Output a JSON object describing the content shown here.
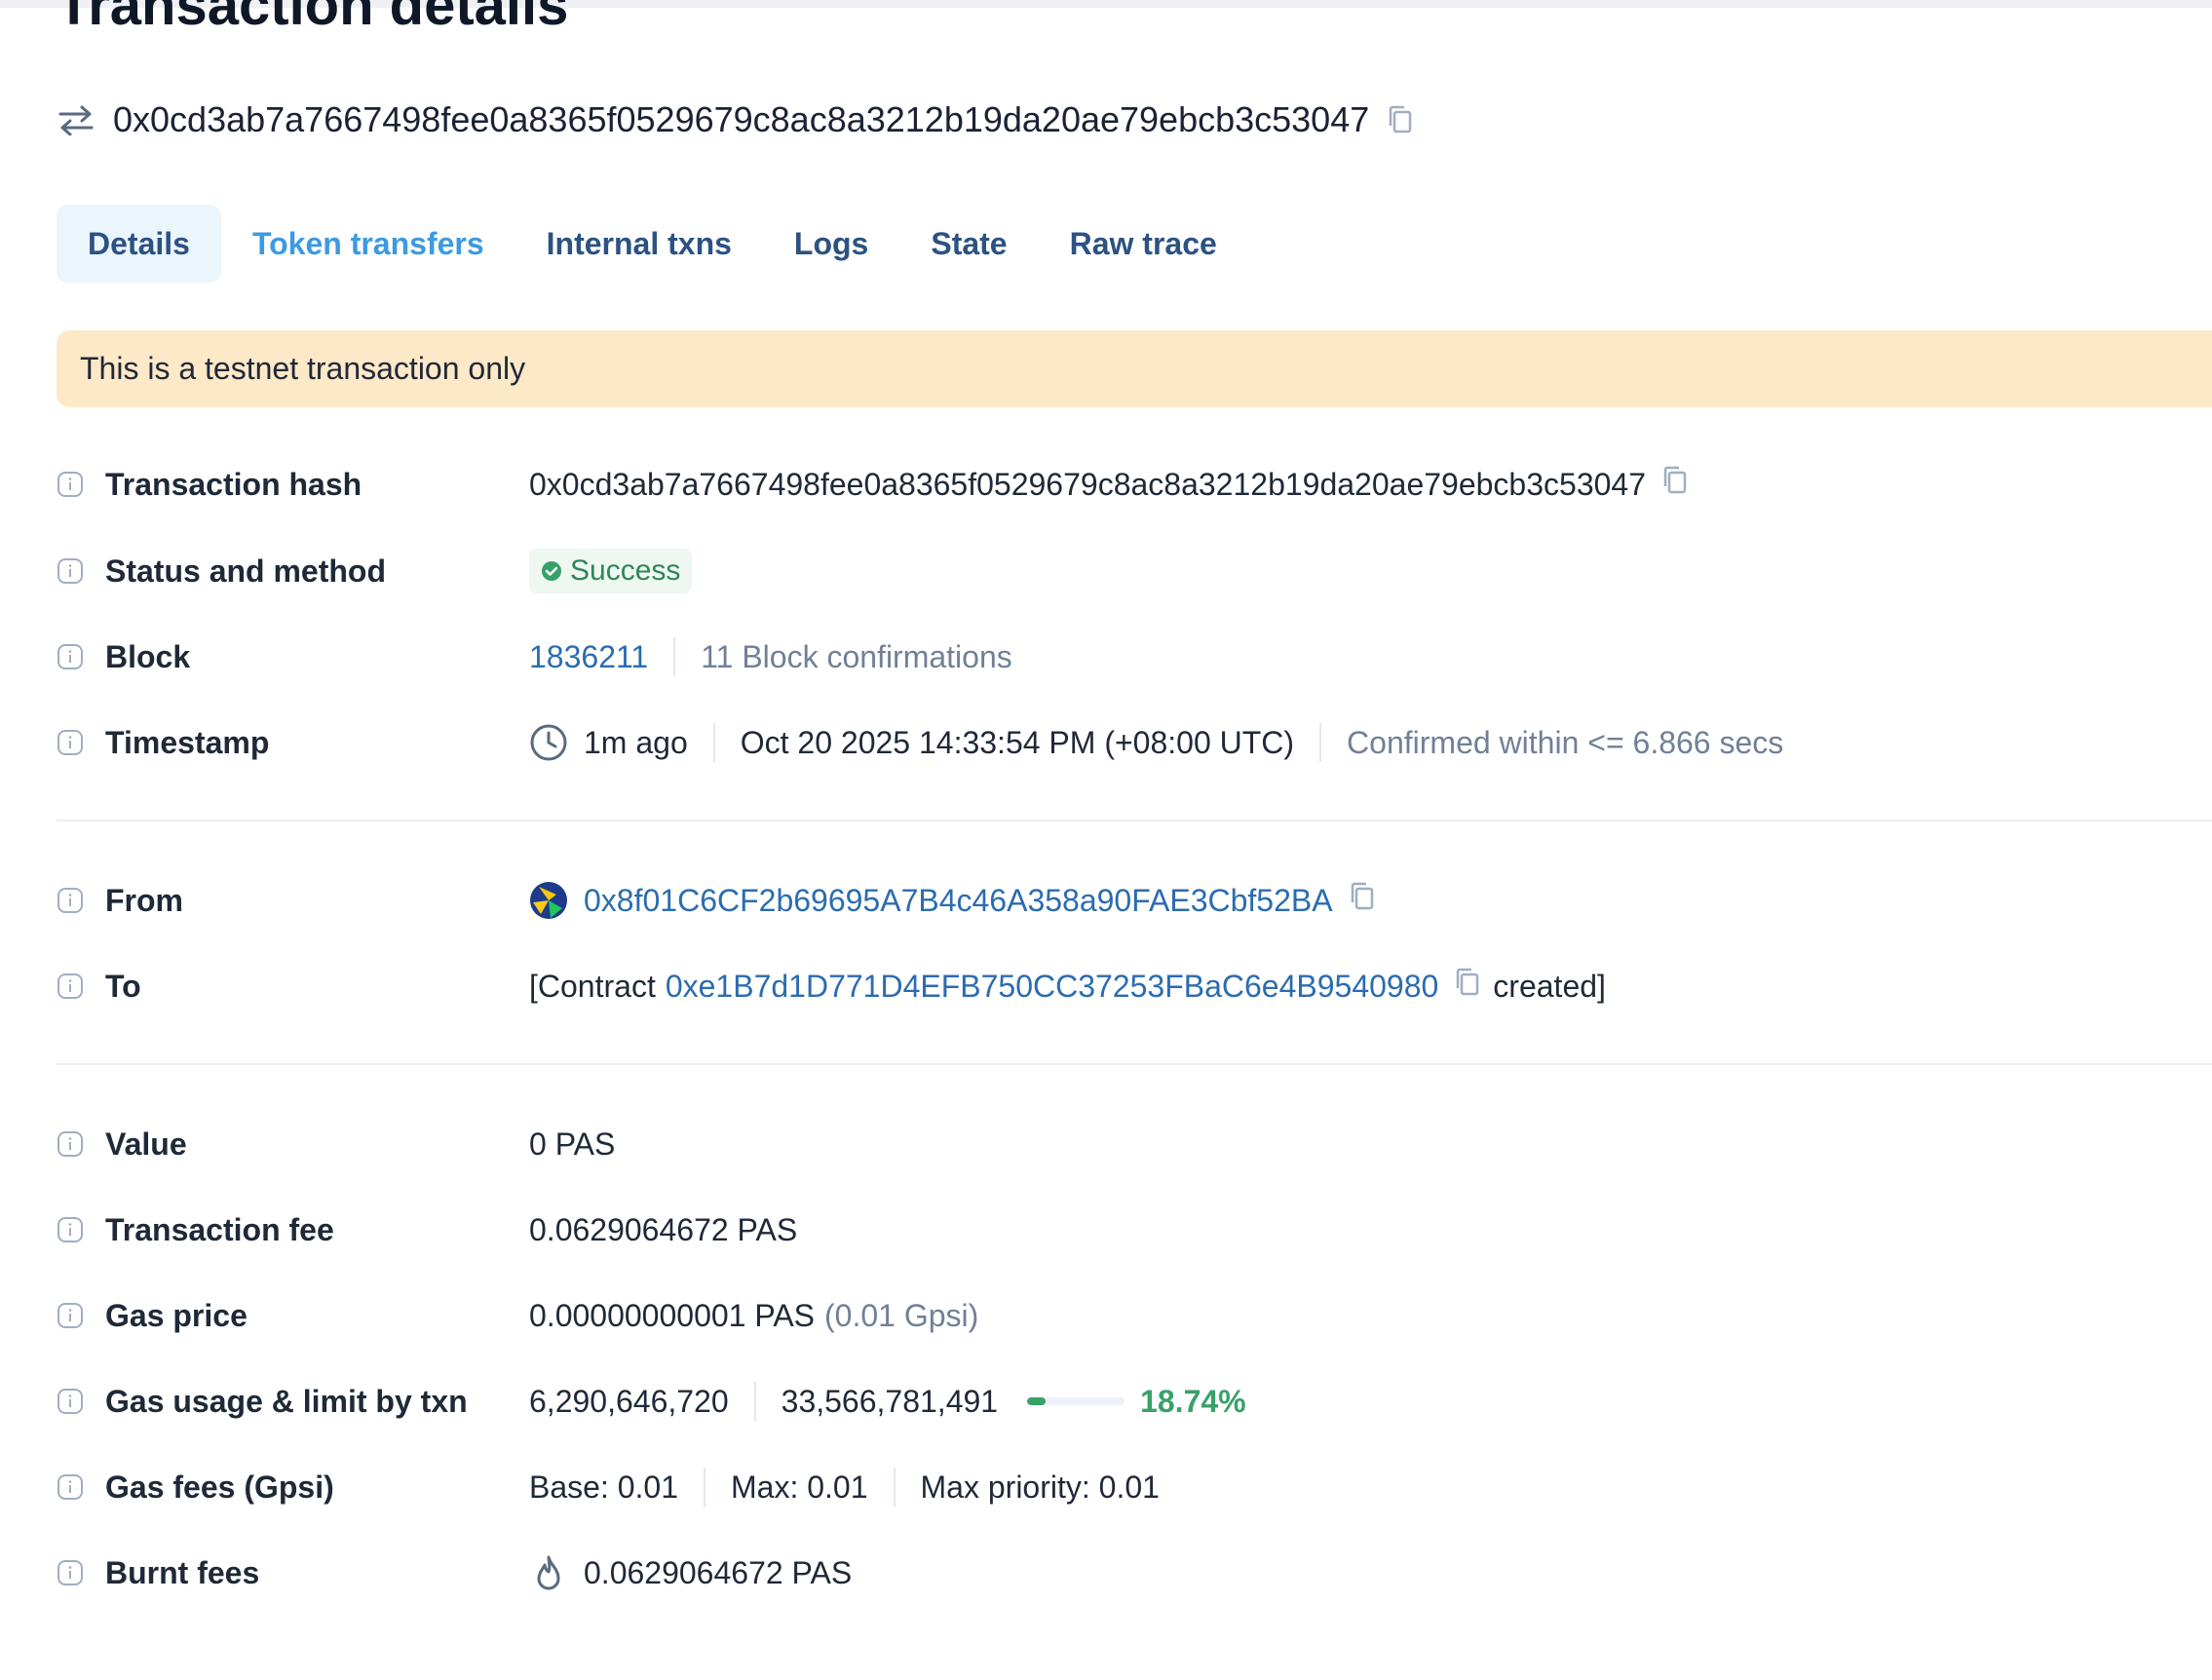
{
  "page": {
    "title": "Transaction details",
    "hash": "0x0cd3ab7a7667498fee0a8365f0529679c8ac8a3212b19da20ae79ebcb3c53047"
  },
  "tabs": [
    {
      "label": "Details",
      "active": true
    },
    {
      "label": "Token transfers",
      "active": false
    },
    {
      "label": "Internal txns",
      "active": false
    },
    {
      "label": "Logs",
      "active": false
    },
    {
      "label": "State",
      "active": false
    },
    {
      "label": "Raw trace",
      "active": false
    }
  ],
  "banner": {
    "text": "This is a testnet transaction only"
  },
  "details": {
    "tx_hash": {
      "label": "Transaction hash",
      "value": "0x0cd3ab7a7667498fee0a8365f0529679c8ac8a3212b19da20ae79ebcb3c53047"
    },
    "status": {
      "label": "Status and method",
      "value": "Success"
    },
    "block": {
      "label": "Block",
      "number": "1836211",
      "confirmations": "11 Block confirmations"
    },
    "timestamp": {
      "label": "Timestamp",
      "relative": "1m ago",
      "absolute": "Oct 20 2025 14:33:54 PM (+08:00 UTC)",
      "confirmed": "Confirmed within <= 6.866 secs"
    },
    "from": {
      "label": "From",
      "address": "0x8f01C6CF2b69695A7B4c46A358a90FAE3Cbf52BA"
    },
    "to": {
      "label": "To",
      "prefix": "[Contract",
      "address": "0xe1B7d1D771D4EFB750CC37253FBaC6e4B9540980",
      "suffix": "created]"
    },
    "value": {
      "label": "Value",
      "value": "0 PAS"
    },
    "fee": {
      "label": "Transaction fee",
      "value": "0.0629064672 PAS"
    },
    "gas_price": {
      "label": "Gas price",
      "value": "0.00000000001 PAS",
      "gwei": "(0.01 Gpsi)"
    },
    "gas_usage": {
      "label": "Gas usage & limit by txn",
      "used": "6,290,646,720",
      "limit": "33,566,781,491",
      "percent": "18.74%",
      "fraction": 0.1874
    },
    "gas_fees": {
      "label": "Gas fees (Gpsi)",
      "base": "Base: 0.01",
      "max": "Max: 0.01",
      "priority": "Max priority: 0.01"
    },
    "burnt": {
      "label": "Burnt fees",
      "value": "0.0629064672 PAS"
    }
  },
  "icons": {
    "info": "info-icon",
    "copy": "copy-icon",
    "swap": "swap-arrows-icon",
    "clock": "clock-icon",
    "fire": "fire-icon",
    "check": "check-circle-icon"
  },
  "colors": {
    "link": "#2b6cb0",
    "success": "#38a169",
    "banner": "#fde8c8",
    "active_tab_bg": "#ebf5fc"
  }
}
